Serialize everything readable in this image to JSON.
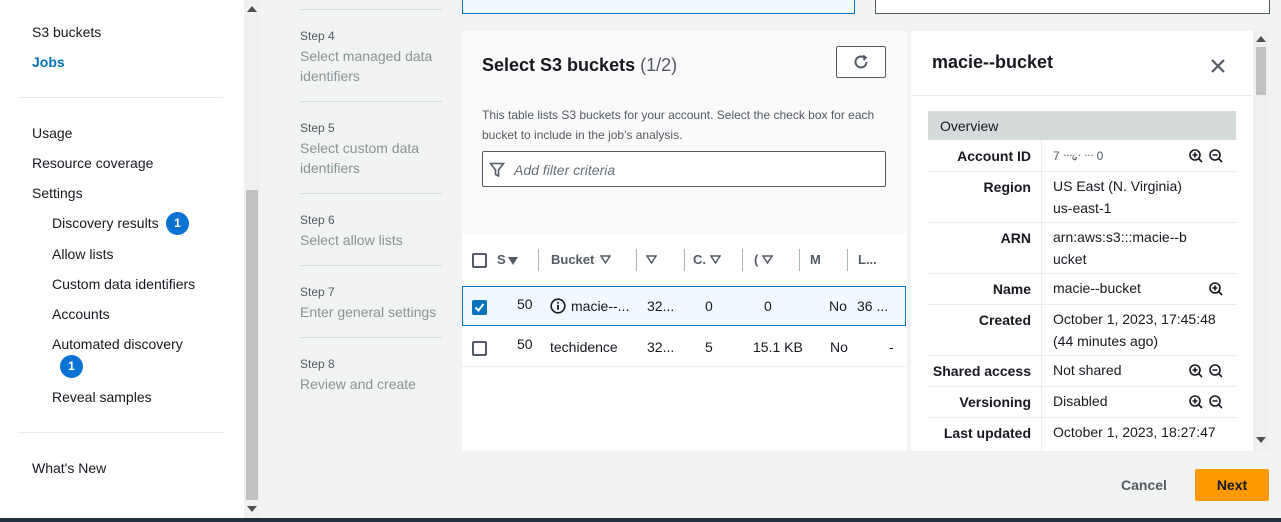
{
  "sidebar": {
    "items": [
      {
        "label": "S3 buckets"
      },
      {
        "label": "Jobs"
      },
      {
        "label": "Usage"
      },
      {
        "label": "Resource coverage"
      },
      {
        "label": "Settings"
      },
      {
        "label": "Discovery results",
        "badge": "1"
      },
      {
        "label": "Allow lists"
      },
      {
        "label": "Custom data identifiers"
      },
      {
        "label": "Accounts"
      },
      {
        "label": "Automated discovery",
        "badge": "1"
      },
      {
        "label": "Reveal samples"
      },
      {
        "label": "What's New"
      }
    ]
  },
  "steps": [
    {
      "step": "Step 4",
      "title": "Select managed data identifiers"
    },
    {
      "step": "Step 5",
      "title": "Select custom data identifiers"
    },
    {
      "step": "Step 6",
      "title": "Select allow lists"
    },
    {
      "step": "Step 7",
      "title": "Enter general settings"
    },
    {
      "step": "Step 8",
      "title": "Review and create"
    }
  ],
  "panel": {
    "title": "Select S3 buckets",
    "count": "(1/2)",
    "description": "This table lists S3 buckets for your account. Select the check box for each bucket to include in the job's analysis.",
    "filter_placeholder": "Add filter criteria"
  },
  "table": {
    "columns": [
      "S",
      "Bucket",
      "",
      "C.",
      "(",
      "M",
      "L..."
    ],
    "rows": [
      {
        "selected": true,
        "col1": "50",
        "bucket": "macie--...",
        "col3": "32...",
        "col4": "0",
        "col5": "0",
        "col6": "No",
        "col7": "36 ..."
      },
      {
        "selected": false,
        "col1": "50",
        "bucket": "techidence",
        "col3": "32...",
        "col4": "5",
        "col5": "15.1 KB",
        "col6": "No",
        "col7": "-"
      }
    ]
  },
  "detail": {
    "title": "macie--bucket",
    "section": "Overview",
    "fields": [
      {
        "key": "Account ID",
        "value": "7 ᐧᐧᐧ᥀ᐧ ᐧᐧᐧ 0"
      },
      {
        "key": "Region",
        "value": "US East (N. Virginia) us-east-1"
      },
      {
        "key": "ARN",
        "value": "arn:aws:s3:::macie--bucket"
      },
      {
        "key": "Name",
        "value": "macie--bucket"
      },
      {
        "key": "Created",
        "value": "October 1, 2023, 17:45:48 (44 minutes ago)"
      },
      {
        "key": "Shared access",
        "value": "Not shared"
      },
      {
        "key": "Versioning",
        "value": "Disabled"
      },
      {
        "key": "Last updated",
        "value": "October 1, 2023, 18:27:47"
      }
    ]
  },
  "footer": {
    "cancel": "Cancel",
    "next": "Next"
  },
  "colors": {
    "accent": "#0073bb",
    "primary_button": "#ff9900",
    "badge": "#0972d3"
  }
}
